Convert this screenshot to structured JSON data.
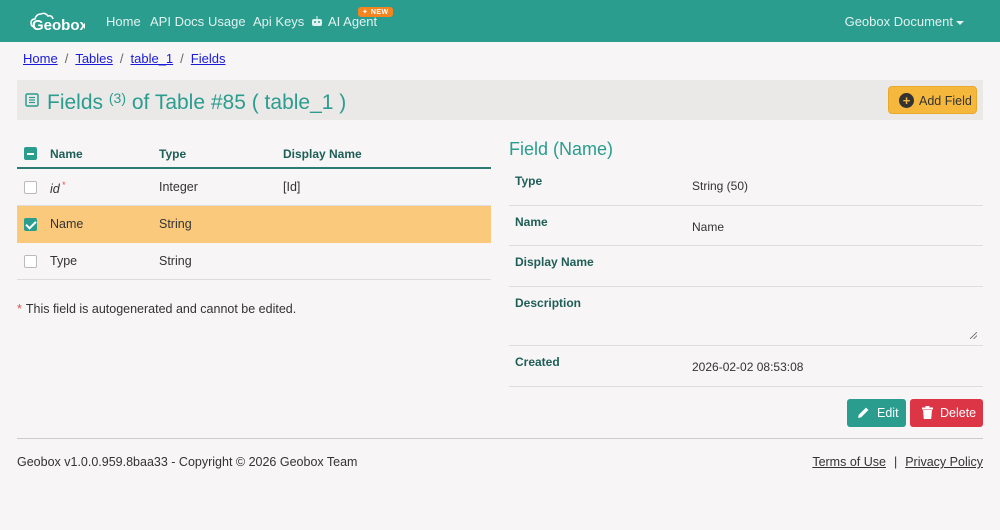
{
  "nav": {
    "logo_text": "Geobox",
    "links": [
      "Home",
      "API Docs",
      "Usage",
      "Api Keys",
      "AI Agent"
    ],
    "new_badge": "NEW",
    "account": "Geobox Document"
  },
  "breadcrumb": [
    "Home",
    "Tables",
    "table_1",
    "Fields"
  ],
  "header": {
    "title": "Fields",
    "count": "(3)",
    "title_suffix": "of Table #85 ( table_1 )",
    "add_button": "Add Field"
  },
  "fields_table": {
    "columns": [
      "Name",
      "Type",
      "Display Name"
    ],
    "rows": [
      {
        "name": "id",
        "type": "Integer",
        "display_name": "[Id]",
        "required": "*",
        "selected": false
      },
      {
        "name": "Name",
        "type": "String",
        "display_name": "",
        "selected": true
      },
      {
        "name": "Type",
        "type": "String",
        "display_name": "",
        "selected": false
      }
    ],
    "note_star": "*",
    "note": "This field is autogenerated and cannot be edited."
  },
  "detail": {
    "title": "Field (Name)",
    "type_label": "Type",
    "type_value": "String (50)",
    "name_label": "Name",
    "name_value": "Name",
    "display_name_label": "Display Name",
    "display_name_value": "",
    "description_label": "Description",
    "description_value": "",
    "created_label": "Created",
    "created_value": "2026-02-02 08:53:08",
    "edit_button": "Edit",
    "delete_button": "Delete"
  },
  "footer": {
    "version": "Geobox v1.0.0.959.8baa33 - Copyright © 2026 Geobox Team",
    "terms": "Terms of Use",
    "sep": "|",
    "privacy": "Privacy Policy"
  },
  "colors": {
    "primary": "#2a9d8f",
    "selected_row": "#fbc97b",
    "add_button": "#f5b83d",
    "delete_button": "#dc3545",
    "link": "#1a1ad8"
  }
}
